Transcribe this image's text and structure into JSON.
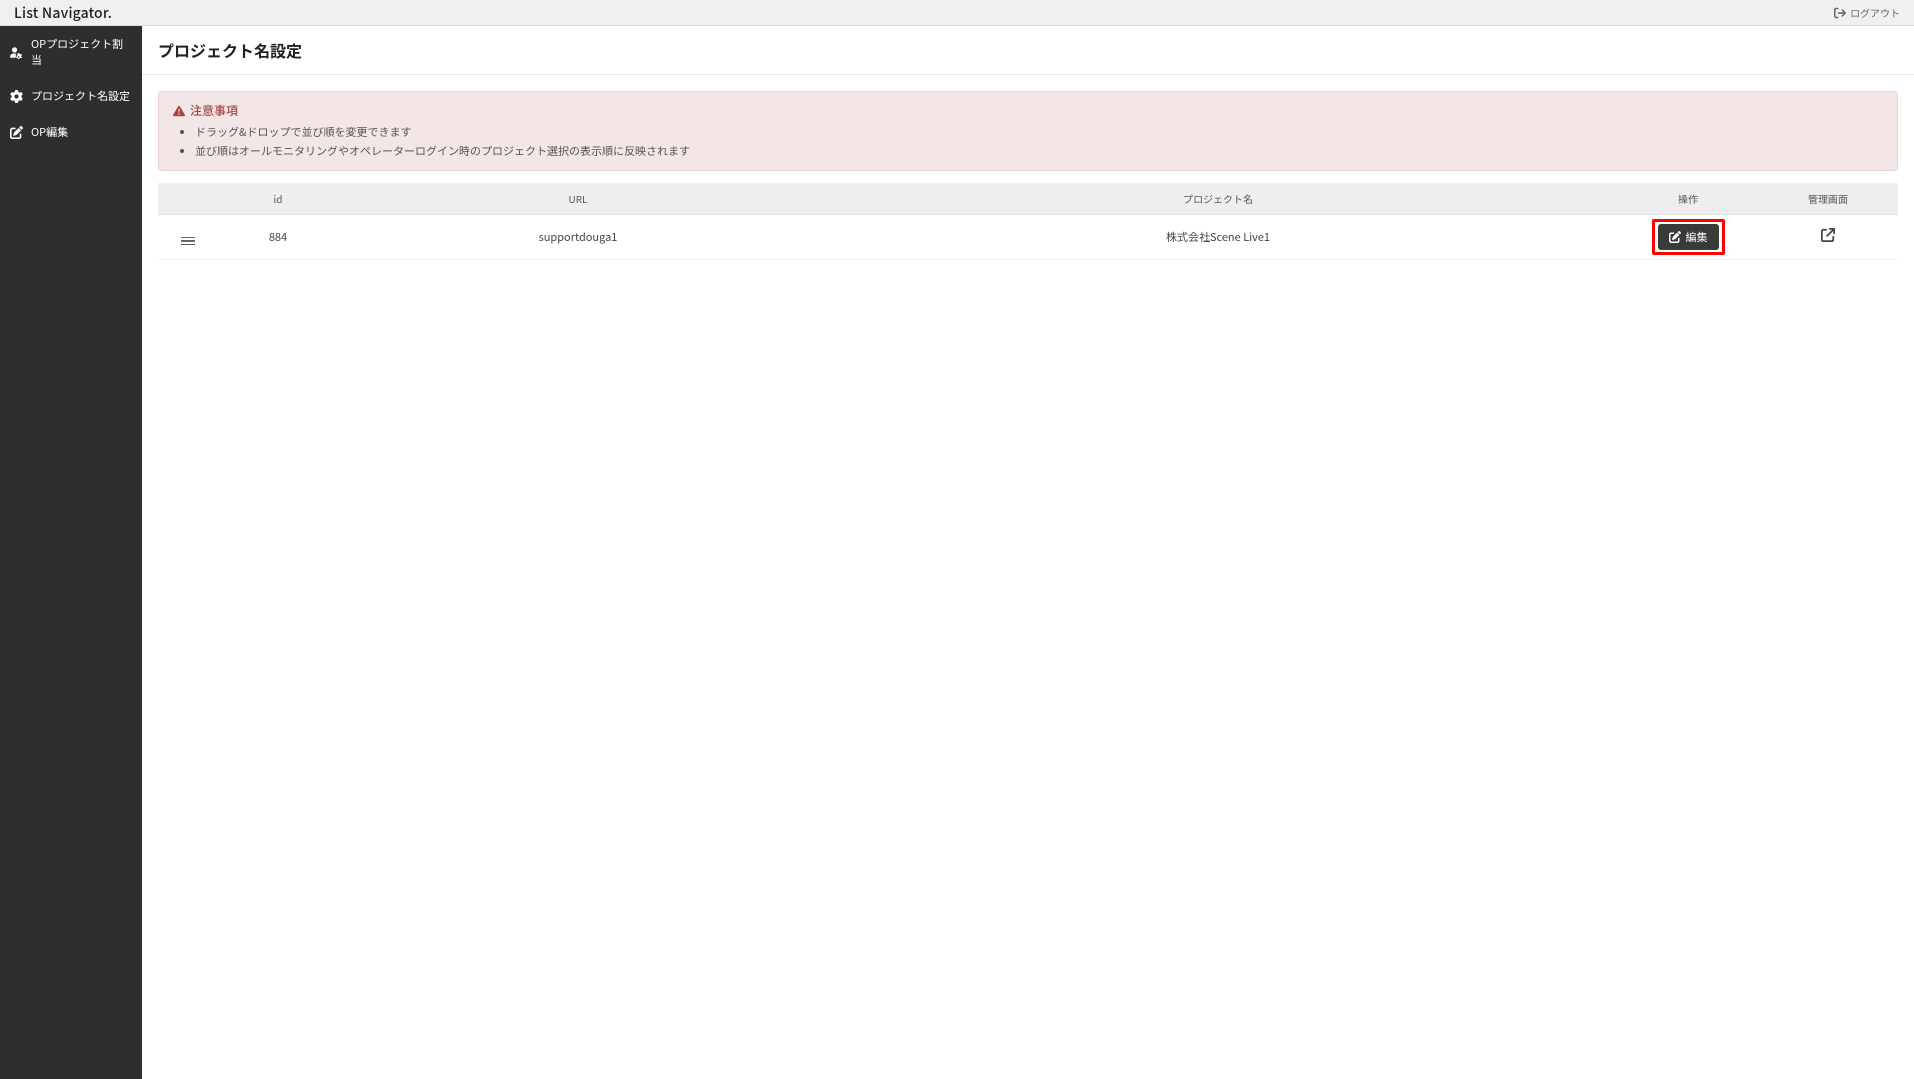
{
  "header": {
    "app_title": "List Navigator.",
    "logout_label": "ログアウト"
  },
  "sidebar": {
    "items": [
      {
        "label": "OPプロジェクト割当",
        "icon": "user-gear-icon"
      },
      {
        "label": "プロジェクト名設定",
        "icon": "gear-icon"
      },
      {
        "label": "OP編集",
        "icon": "edit-icon"
      }
    ]
  },
  "page": {
    "title": "プロジェクト名設定"
  },
  "notice": {
    "title": "注意事項",
    "items": [
      "ドラッグ&ドロップで並び順を変更できます",
      "並び順はオールモニタリングやオペレーターログイン時のプロジェクト選択の表示順に反映されます"
    ]
  },
  "table": {
    "headers": {
      "id": "id",
      "url": "URL",
      "project_name": "プロジェクト名",
      "action": "操作",
      "admin_screen": "管理画面"
    },
    "rows": [
      {
        "id": "884",
        "url": "supportdouga1",
        "project_name": "株式会社Scene Live1",
        "edit_label": "編集"
      }
    ]
  }
}
